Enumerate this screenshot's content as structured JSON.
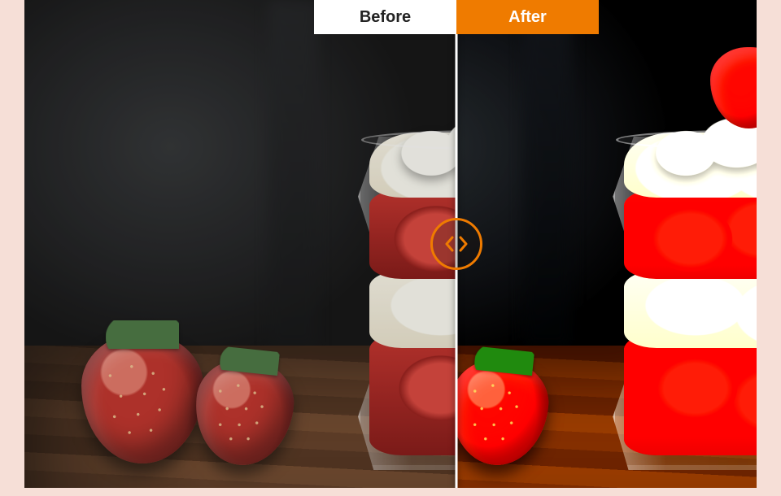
{
  "slider": {
    "before_label": "Before",
    "after_label": "After",
    "split_percent": 59,
    "accent_color": "#ef7b00"
  }
}
